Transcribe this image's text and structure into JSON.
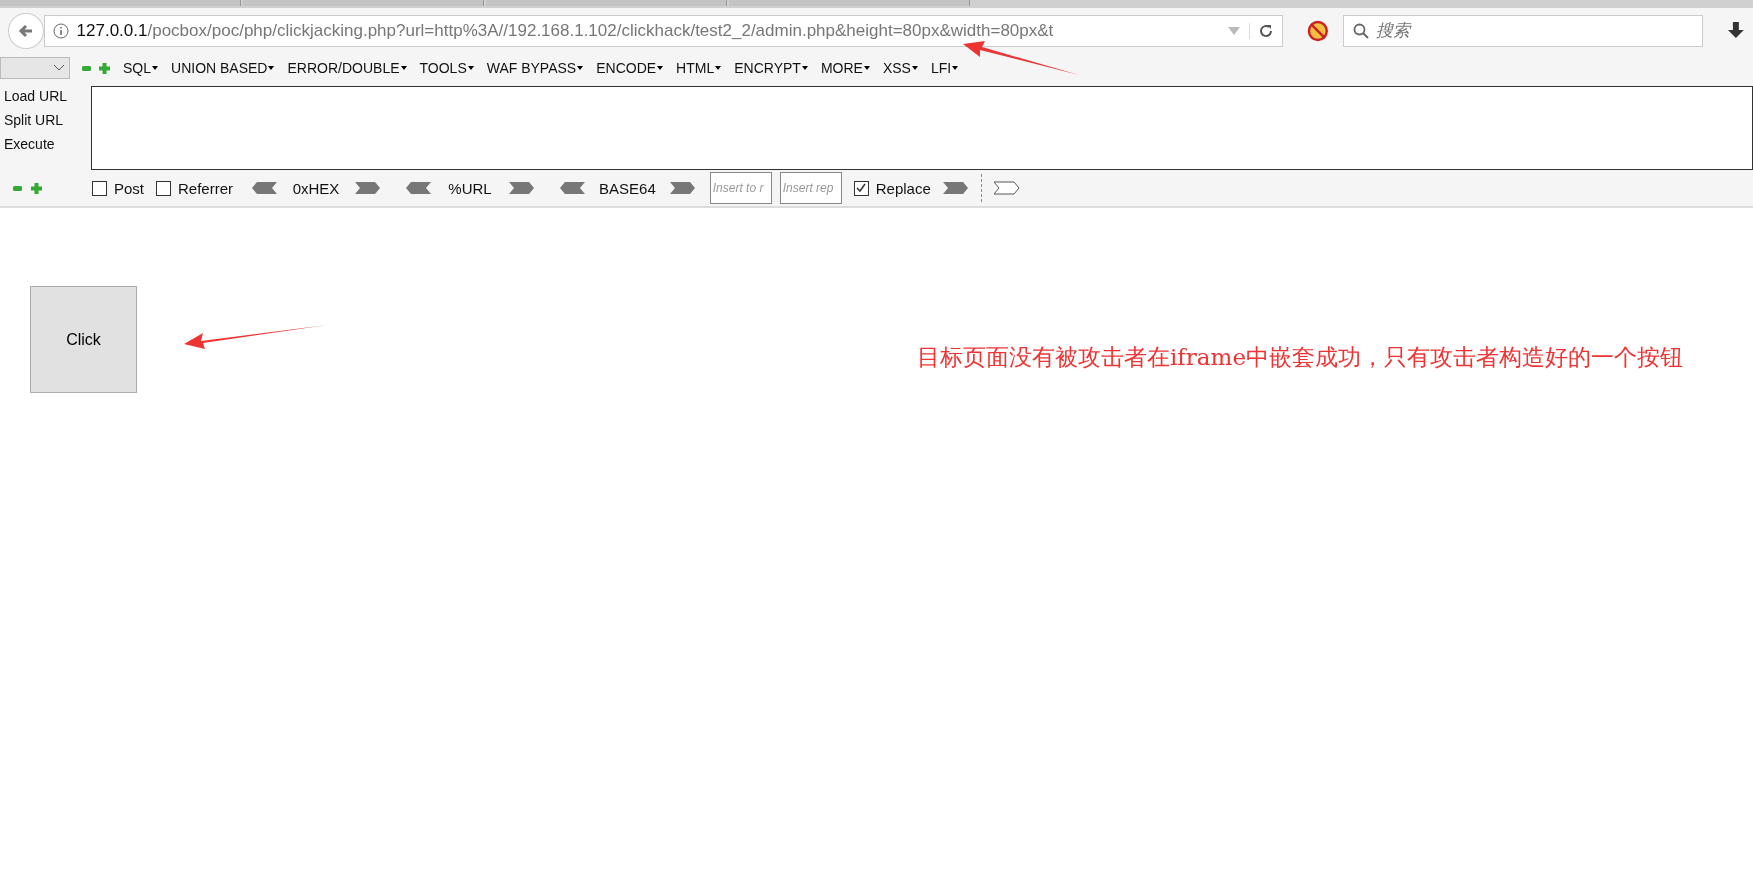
{
  "browser": {
    "url_host": "127.0.0.1",
    "url_rest": "/pocbox/poc/php/clickjacking.php?url=http%3A//192.168.1.102/clickhack/test2_2/admin.php&height=80px&width=80px&t",
    "search": {
      "placeholder": "搜索"
    }
  },
  "hackbar": {
    "menus": [
      "SQL",
      "UNION BASED",
      "ERROR/DOUBLE",
      "TOOLS",
      "WAF BYPASS",
      "ENCODE",
      "HTML",
      "ENCRYPT",
      "MORE",
      "XSS",
      "LFI"
    ],
    "actions": [
      "Load URL",
      "Split URL",
      "Execute"
    ],
    "options": [
      {
        "label": "Post",
        "checked": false
      },
      {
        "label": "Referrer",
        "checked": false
      }
    ],
    "encoders": [
      "0xHEX",
      "%URL",
      "BASE64"
    ],
    "insert_fields": [
      {
        "placeholder": "Insert to r"
      },
      {
        "placeholder": "Insert rep"
      }
    ],
    "replace": {
      "label": "Replace",
      "checked": true
    }
  },
  "page": {
    "button": "Click"
  },
  "annotation": {
    "text": "目标页面没有被攻击者在iframe中嵌套成功，只有攻击者构造好的一个按钮"
  }
}
